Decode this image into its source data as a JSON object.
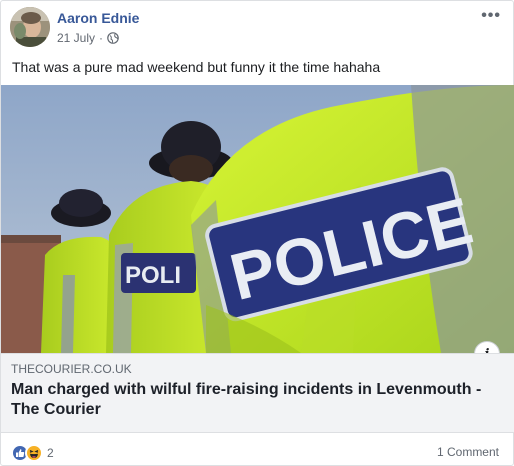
{
  "post": {
    "author": "Aaron Ednie",
    "date": "21 July",
    "separator": "·",
    "privacy_icon": "globe-icon",
    "more_icon": "more-options-icon",
    "more_label": "•••",
    "text": "That was a pure mad weekend but funny it the time hahaha"
  },
  "link_preview": {
    "image_alt": "police officers in hi-vis jackets",
    "image_texts": [
      "POLICE",
      "POLI"
    ],
    "info_label": "i",
    "domain": "THECOURIER.CO.UK",
    "title_line1": "Man charged with wilful fire-raising incidents in Levenmouth -",
    "title_line2": "The Courier"
  },
  "footer": {
    "reaction_icons": [
      "like-icon",
      "haha-icon"
    ],
    "reaction_count": "2",
    "comments": "1 Comment"
  },
  "colors": {
    "author": "#385898",
    "hivis": "#c8f02a",
    "police_patch": "#2a3a8c",
    "card_bg": "#f2f3f5"
  }
}
